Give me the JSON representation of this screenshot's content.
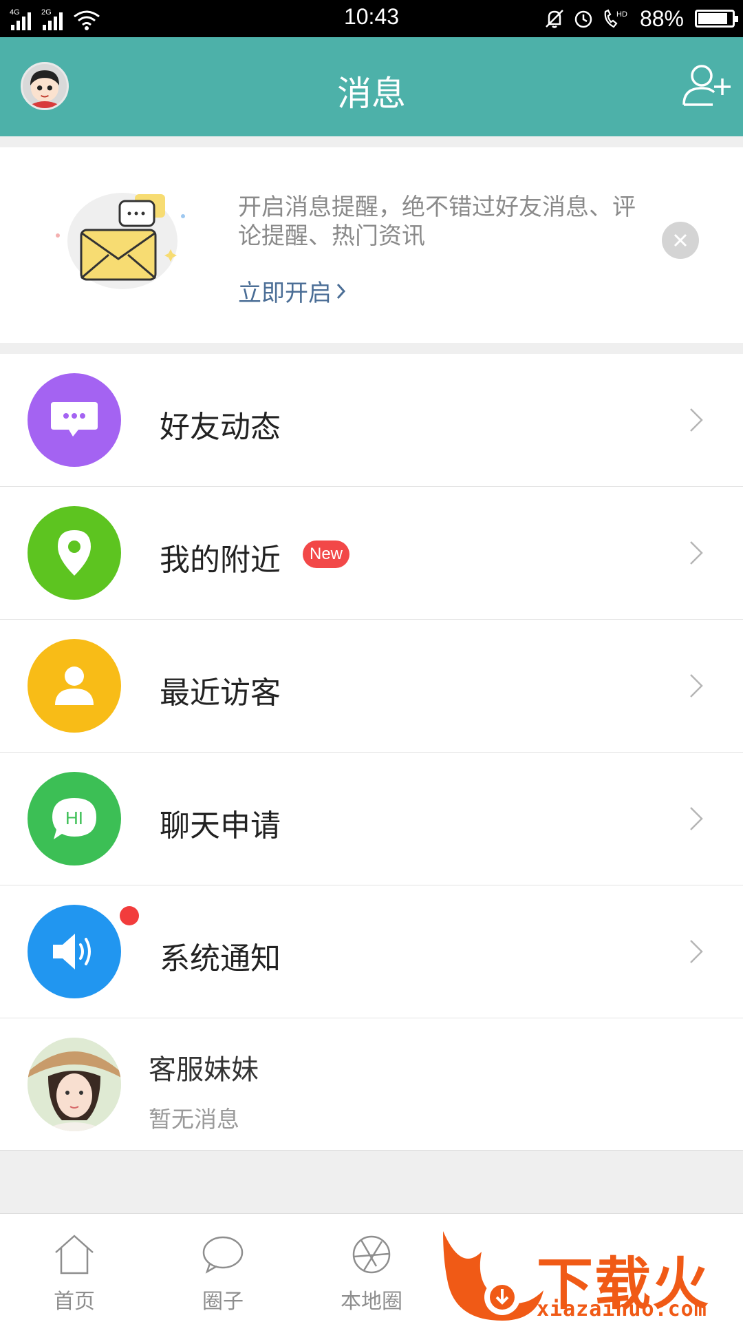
{
  "status_bar": {
    "network_1": "4G",
    "network_2": "2G",
    "time": "10:43",
    "battery": "88%",
    "battery_level": 0.88,
    "icons": [
      "mute-bell-icon",
      "alarm-icon",
      "hd-call-icon",
      "battery-icon",
      "wifi-icon",
      "signal-icon"
    ]
  },
  "header": {
    "title": "消息",
    "left_icon": "avatar-icon",
    "right_icon": "add-friend-icon"
  },
  "banner": {
    "text": "开启消息提醒，绝不错过好友消息、评论提醒、热门资讯",
    "link": "立即开启",
    "link_icon": "chevron-right-icon",
    "close_icon": "close-icon",
    "illustration": "envelope-icon"
  },
  "list": {
    "items": [
      {
        "label": "好友动态",
        "icon": "chat-bubble-icon",
        "color": "#a463f2"
      },
      {
        "label": "我的附近",
        "icon": "location-pin-icon",
        "color": "#5dc420",
        "badge": "New"
      },
      {
        "label": "最近访客",
        "icon": "person-icon",
        "color": "#f8bc17"
      },
      {
        "label": "聊天申请",
        "icon": "hi-bubble-icon",
        "color": "#3cbf55",
        "icon_text": "HI"
      },
      {
        "label": "系统通知",
        "icon": "speaker-icon",
        "color": "#2196f0"
      }
    ],
    "customer_service": {
      "name": "客服妹妹",
      "subtitle": "暂无消息"
    }
  },
  "bottom_nav": {
    "tabs": [
      {
        "label": "首页",
        "icon": "home-icon"
      },
      {
        "label": "圈子",
        "icon": "chat-circle-icon"
      },
      {
        "label": "本地圈",
        "icon": "aperture-icon"
      }
    ]
  },
  "watermark": {
    "brand": "下载火",
    "url": "xiazaihuo.com"
  },
  "colors": {
    "header_bg": "#4db1a9",
    "link": "#4b6e96",
    "badge": "#f24848"
  }
}
